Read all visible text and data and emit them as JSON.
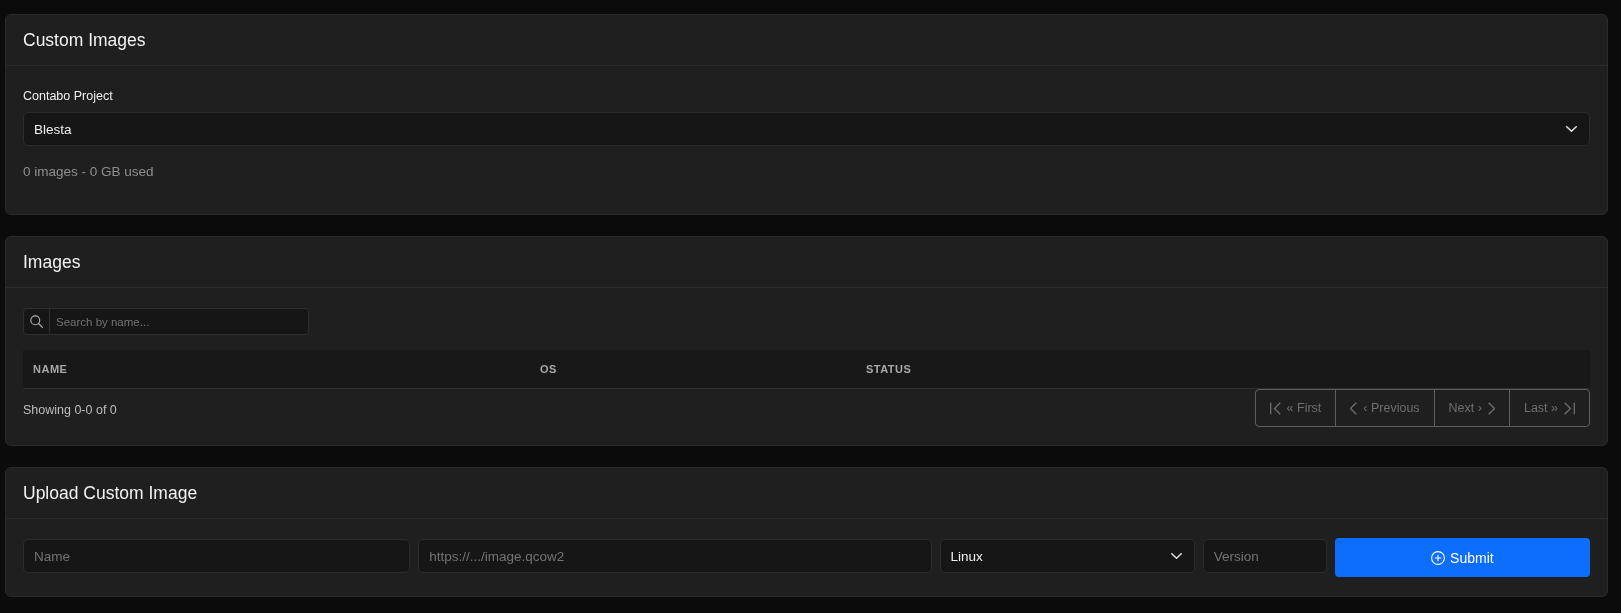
{
  "project_card": {
    "title": "Custom Images",
    "project_select": {
      "label": "Contabo Project",
      "value": "Blesta"
    },
    "usage": "0 images - 0 GB used"
  },
  "images_card": {
    "title": "Images",
    "search": {
      "placeholder": "Search by name..."
    },
    "table": {
      "columns": [
        "NAME",
        "OS",
        "STATUS"
      ]
    },
    "showing": "Showing 0-0 of 0",
    "pagination": [
      {
        "kind": "first",
        "label": "« First",
        "disabled": true
      },
      {
        "kind": "previous",
        "label": "‹ Previous",
        "disabled": true
      },
      {
        "kind": "next",
        "label": "Next ›",
        "disabled": true
      },
      {
        "kind": "last",
        "label": "Last »",
        "disabled": true
      }
    ]
  },
  "upload_card": {
    "title": "Upload Custom Image",
    "name_field": {
      "placeholder": "Name"
    },
    "url_field": {
      "placeholder": "https://.../image.qcow2"
    },
    "os_select": {
      "value": "Linux"
    },
    "version_field": {
      "placeholder": "Version"
    },
    "submit_button": {
      "label": "Submit"
    }
  }
}
